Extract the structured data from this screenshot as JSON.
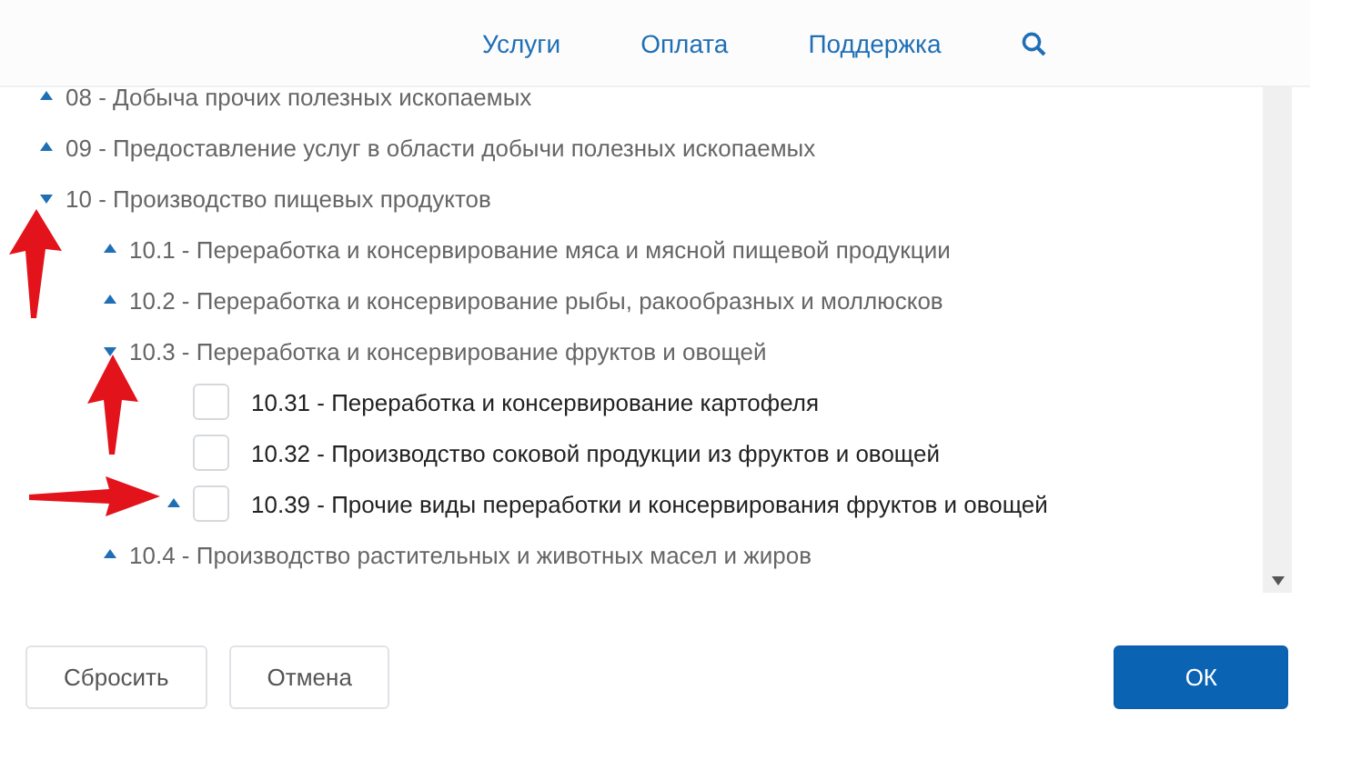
{
  "nav": {
    "links": [
      "Услуги",
      "Оплата",
      "Поддержка"
    ]
  },
  "tree": [
    {
      "label": "08 - Добыча прочих полезных ископаемых",
      "expanded": false
    },
    {
      "label": "09 - Предоставление услуг в области добычи полезных ископаемых",
      "expanded": false
    },
    {
      "label": "10 - Производство пищевых продуктов",
      "expanded": true,
      "children": [
        {
          "label": "10.1 - Переработка и консервирование мяса и мясной пищевой продукции",
          "expanded": false
        },
        {
          "label": "10.2 - Переработка и консервирование рыбы, ракообразных и моллюсков",
          "expanded": false
        },
        {
          "label": "10.3 - Переработка и консервирование фруктов и овощей",
          "expanded": true,
          "children": [
            {
              "label": "10.31 - Переработка и консервирование картофеля",
              "kind": "leaf",
              "checked": false
            },
            {
              "label": "10.32 - Производство соковой продукции из фруктов и овощей",
              "kind": "leaf",
              "checked": false
            },
            {
              "label": "10.39 - Прочие виды переработки и консервирования фруктов и овощей",
              "kind": "leaf",
              "checked": false,
              "expanded": false
            }
          ]
        },
        {
          "label": "10.4 - Производство растительных и животных масел и жиров",
          "expanded": false
        }
      ]
    }
  ],
  "buttons": [
    {
      "label": "Сбросить",
      "kind": "secondary"
    },
    {
      "label": "Отмена",
      "kind": "secondary"
    },
    {
      "label": "ОК",
      "kind": "primary"
    }
  ]
}
